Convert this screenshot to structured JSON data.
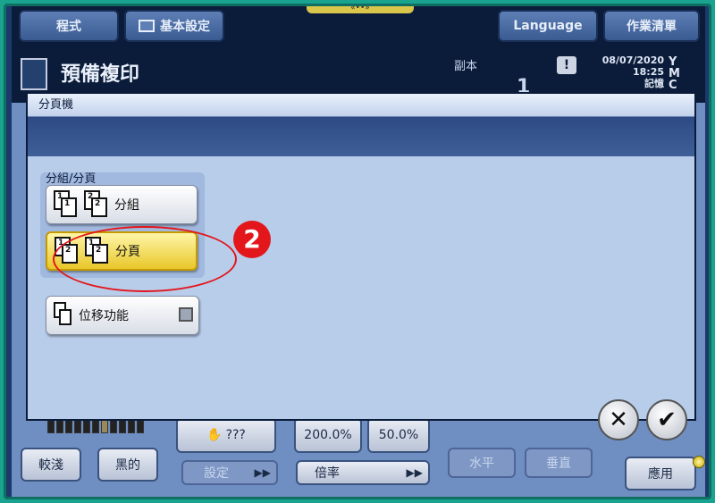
{
  "topbar": {
    "program_label": "程式",
    "basic_settings_label": "基本設定",
    "notch_marks": "«••»",
    "language_label": "Language",
    "job_list_label": "作業清單"
  },
  "infobar": {
    "title": "預備複印",
    "copies_label": "副本",
    "copies_value": "1",
    "warning": "!",
    "date": "08/07/2020",
    "time": "18:25",
    "memory": "記憶",
    "toner_y": "Y",
    "toner_m": "M",
    "toner_c": "C"
  },
  "dialog": {
    "title": "分頁機",
    "group_label": "分組/分頁",
    "group_button": "分組",
    "sort_button": "分頁",
    "offset_button": "位移功能",
    "step_number": "2",
    "cancel_symbol": "✕",
    "ok_symbol": "✔"
  },
  "bottom": {
    "lighter": "較淺",
    "darker": "黑的",
    "unknown": "???",
    "settings": "設定",
    "zoom_up": "200.0%",
    "zoom_down": "50.0%",
    "ratio": "倍率",
    "horizontal": "水平",
    "vertical": "垂直",
    "apply": "應用"
  },
  "colors": {
    "highlight": "#e3161b",
    "selected_button": "#e8c72a",
    "dialog_bg": "#b8cdea"
  }
}
